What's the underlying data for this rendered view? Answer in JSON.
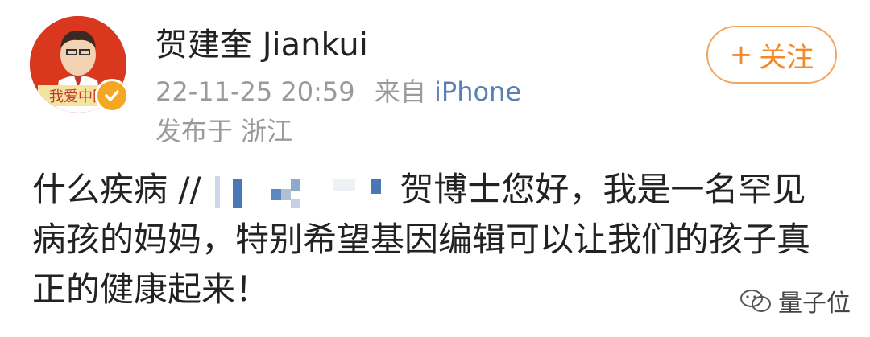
{
  "header": {
    "username": "贺建奎 Jiankui",
    "timestamp": "22-11-25 20:59",
    "source_prefix": "来自",
    "source": "iPhone",
    "location": "发布于 浙江",
    "follow_label": "关注",
    "follow_icon": "+",
    "avatar_caption": "我爱中国"
  },
  "post": {
    "text_before": "什么疾病 //",
    "text_after": "贺博士您好，我是一名罕见病孩的妈妈，特别希望基因编辑可以让我们的孩子真正的健康起来！"
  },
  "watermark": {
    "label": "量子位"
  },
  "colors": {
    "accent": "#f08a2c",
    "source_link": "#5b7fb5",
    "meta_gray": "#9a9a9a",
    "avatar_bg": "#d9381e",
    "verified_badge": "#f5a623"
  }
}
